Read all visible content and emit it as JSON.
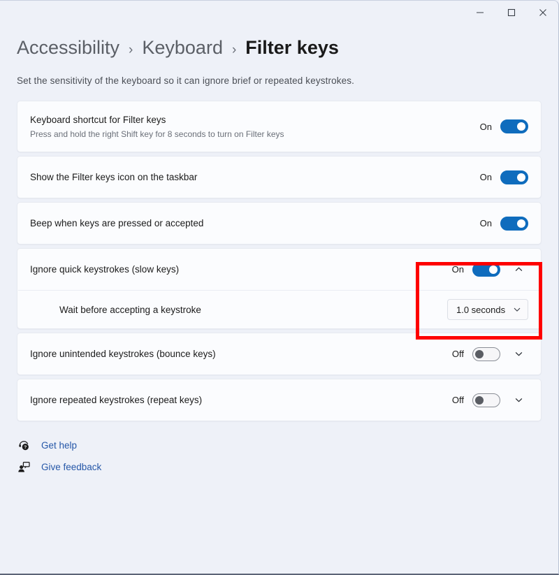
{
  "window": {
    "controls": {
      "minimize": "Minimize",
      "maximize": "Maximize",
      "close": "Close"
    }
  },
  "header": {
    "breadcrumb": [
      {
        "label": "Accessibility",
        "current": false
      },
      {
        "label": "Keyboard",
        "current": false
      },
      {
        "label": "Filter keys",
        "current": true
      }
    ],
    "separator": "›",
    "subtitle": "Set the sensitivity of the keyboard so it can ignore brief or repeated keystrokes."
  },
  "settings": [
    {
      "title": "Keyboard shortcut for Filter keys",
      "description": "Press and hold the right Shift key for 8 seconds to turn on Filter keys",
      "state_label": "On",
      "toggle_state": "on",
      "expandable": false
    },
    {
      "title": "Show the Filter keys icon on the taskbar",
      "description": "",
      "state_label": "On",
      "toggle_state": "on",
      "expandable": false
    },
    {
      "title": "Beep when keys are pressed or accepted",
      "description": "",
      "state_label": "On",
      "toggle_state": "on",
      "expandable": false
    },
    {
      "title": "Ignore quick keystrokes (slow keys)",
      "description": "",
      "state_label": "On",
      "toggle_state": "on",
      "expandable": true,
      "expanded": true,
      "sub_row": {
        "title": "Wait before accepting a keystroke",
        "dropdown_value": "1.0 seconds"
      }
    },
    {
      "title": "Ignore unintended keystrokes (bounce keys)",
      "description": "",
      "state_label": "Off",
      "toggle_state": "off",
      "expandable": true,
      "expanded": false
    },
    {
      "title": "Ignore repeated keystrokes (repeat keys)",
      "description": "",
      "state_label": "Off",
      "toggle_state": "off",
      "expandable": true,
      "expanded": false
    }
  ],
  "footer": {
    "links": [
      {
        "label": "Get help",
        "icon": "get-help-icon"
      },
      {
        "label": "Give feedback",
        "icon": "give-feedback-icon"
      }
    ]
  },
  "annotation": {
    "color": "#fe0000",
    "target": "Ignore quick keystrokes toggle and wait-time dropdown"
  },
  "colors": {
    "accent": "#0f6cbd",
    "page_background": "#eef1f8",
    "card_background": "#fbfcfe",
    "link": "#2557a8",
    "annotation": "#fe0000"
  }
}
